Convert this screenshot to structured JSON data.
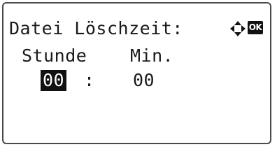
{
  "screen": {
    "title": "Datei Löschzeit:",
    "hour_label": "Stunde",
    "minute_label": "Min.",
    "hour_value": "00",
    "separator": ":",
    "minute_value": "00",
    "ok_label": "OK",
    "nav_icon": "four-way-arrow-icon"
  }
}
